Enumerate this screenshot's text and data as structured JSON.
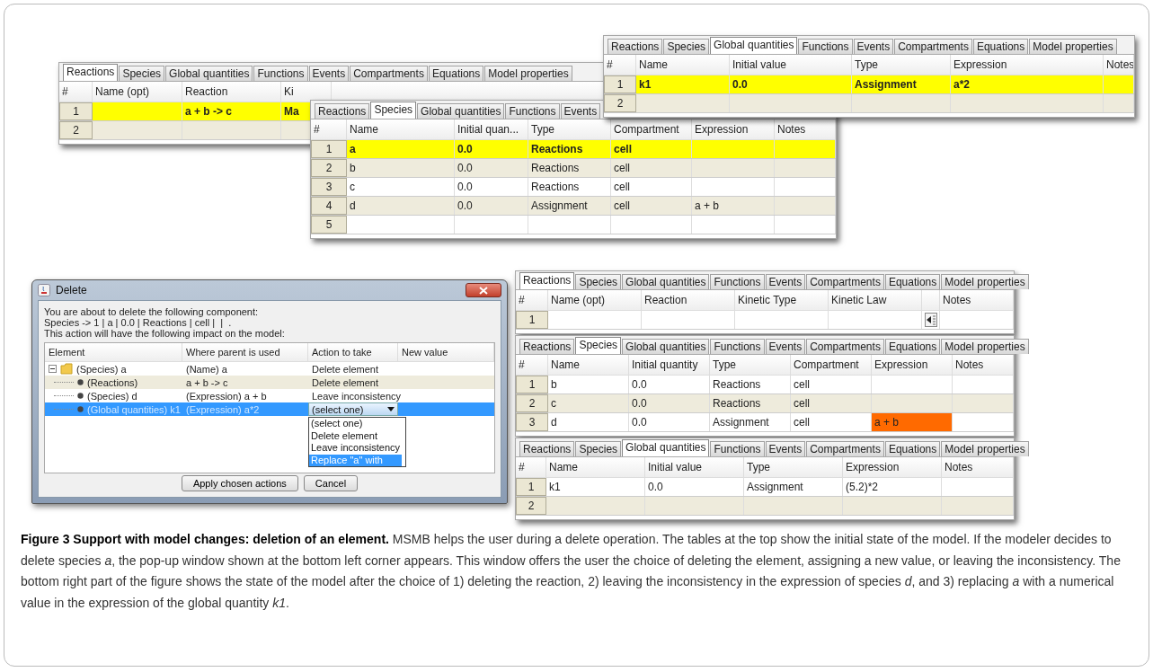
{
  "panels": [
    {
      "tabs": [
        {
          "label": "Reactions",
          "selected": true
        },
        {
          "label": "Species",
          "selected": false
        },
        {
          "label": "Global quantities",
          "selected": false
        },
        {
          "label": "Functions",
          "selected": false
        },
        {
          "label": "Events",
          "selected": false
        },
        {
          "label": "Compartments",
          "selected": false
        },
        {
          "label": "Equations",
          "selected": false
        },
        {
          "label": "Model properties",
          "selected": false
        }
      ],
      "columns": [
        "#",
        "Name (opt)",
        "Reaction",
        "Ki"
      ],
      "editor_column": false,
      "rows": [
        {
          "highlighted": true,
          "cells": [
            "1",
            null,
            "a + b -> c",
            "Ma"
          ]
        },
        {
          "highlighted": false,
          "cells": [
            "2"
          ]
        }
      ]
    },
    {
      "tabs": [
        {
          "label": "Reactions",
          "selected": false
        },
        {
          "label": "Species",
          "selected": false
        },
        {
          "label": "Global quantities",
          "selected": true
        },
        {
          "label": "Functions",
          "selected": false
        },
        {
          "label": "Events",
          "selected": false
        },
        {
          "label": "Compartments",
          "selected": false
        },
        {
          "label": "Equations",
          "selected": false
        },
        {
          "label": "Model properties",
          "selected": false
        }
      ],
      "columns": [
        "#",
        "Name",
        "Initial value",
        "Type",
        "Expression",
        "Notes"
      ],
      "editor_column": false,
      "rows": [
        {
          "highlighted": true,
          "cells": [
            "1",
            "k1",
            "0.0",
            "Assignment",
            "a*2",
            null
          ]
        },
        {
          "highlighted": false,
          "cells": [
            "2"
          ]
        }
      ]
    },
    {
      "tabs": [
        {
          "label": "Reactions",
          "selected": false
        },
        {
          "label": "Species",
          "selected": true
        },
        {
          "label": "Global quantities",
          "selected": false
        },
        {
          "label": "Functions",
          "selected": false
        },
        {
          "label": "Events",
          "selected": false
        }
      ],
      "columns": [
        "#",
        "Name",
        "Initial quan...",
        "Type",
        "Compartment",
        "Expression",
        "Notes"
      ],
      "editor_column": false,
      "rows": [
        {
          "highlighted": true,
          "cells": [
            "1",
            "a",
            "0.0",
            "Reactions",
            "cell",
            null,
            null
          ]
        },
        {
          "highlighted": false,
          "cells": [
            "2",
            "b",
            "0.0",
            "Reactions",
            "cell",
            null,
            null
          ]
        },
        {
          "highlighted": false,
          "cells": [
            "3",
            "c",
            "0.0",
            "Reactions",
            "cell",
            null,
            null
          ]
        },
        {
          "highlighted": false,
          "cells": [
            "4",
            "d",
            "0.0",
            "Assignment",
            "cell",
            "a + b",
            null
          ]
        },
        {
          "highlighted": false,
          "cells": [
            "5"
          ]
        }
      ]
    },
    {
      "tabs": [
        {
          "label": "Reactions",
          "selected": true
        },
        {
          "label": "Species",
          "selected": false
        },
        {
          "label": "Global quantities",
          "selected": false
        },
        {
          "label": "Functions",
          "selected": false
        },
        {
          "label": "Events",
          "selected": false
        },
        {
          "label": "Compartments",
          "selected": false
        },
        {
          "label": "Equations",
          "selected": false
        },
        {
          "label": "Model properties",
          "selected": false
        }
      ],
      "columns": [
        "#",
        "Name (opt)",
        "Reaction",
        "Kinetic Type",
        "Kinetic Law",
        "Notes"
      ],
      "editor_column": true,
      "rows": [
        {
          "highlighted": false,
          "cells": [
            "1"
          ]
        }
      ]
    },
    {
      "tabs": [
        {
          "label": "Reactions",
          "selected": false
        },
        {
          "label": "Species",
          "selected": true
        },
        {
          "label": "Global quantities",
          "selected": false
        },
        {
          "label": "Functions",
          "selected": false
        },
        {
          "label": "Events",
          "selected": false
        },
        {
          "label": "Compartments",
          "selected": false
        },
        {
          "label": "Equations",
          "selected": false
        },
        {
          "label": "Model properties",
          "selected": false
        }
      ],
      "columns": [
        "#",
        "Name",
        "Initial quantity",
        "Type",
        "Compartment",
        "Expression",
        "Notes"
      ],
      "editor_column": false,
      "rows": [
        {
          "highlighted": false,
          "cells": [
            "1",
            "b",
            "0.0",
            "Reactions",
            "cell",
            null,
            null
          ]
        },
        {
          "highlighted": false,
          "cells": [
            "2",
            "c",
            "0.0",
            "Reactions",
            "cell",
            null,
            null
          ]
        },
        {
          "highlighted": false,
          "cells": [
            "3",
            "d",
            "0.0",
            "Assignment",
            "cell",
            {
              "text": "a + b",
              "invalid": true
            },
            null
          ]
        }
      ]
    },
    {
      "tabs": [
        {
          "label": "Reactions",
          "selected": false
        },
        {
          "label": "Species",
          "selected": false
        },
        {
          "label": "Global quantities",
          "selected": true
        },
        {
          "label": "Functions",
          "selected": false
        },
        {
          "label": "Events",
          "selected": false
        },
        {
          "label": "Compartments",
          "selected": false
        },
        {
          "label": "Equations",
          "selected": false
        },
        {
          "label": "Model properties",
          "selected": false
        }
      ],
      "columns": [
        "#",
        "Name",
        "Initial value",
        "Type",
        "Expression",
        "Notes"
      ],
      "editor_column": false,
      "rows": [
        {
          "highlighted": false,
          "cells": [
            "1",
            "k1",
            "0.0",
            "Assignment",
            "(5.2)*2",
            null
          ]
        },
        {
          "highlighted": false,
          "cells": [
            "2"
          ]
        }
      ]
    }
  ],
  "dialog": {
    "title": "Delete",
    "message": [
      "You are about to delete the following component:",
      "Species -> 1 | a | 0.0 | Reactions | cell |  |  .",
      "This action will have the following impact on the model:"
    ],
    "columns": [
      "Element",
      "Where parent is used",
      "Action to take",
      "New value"
    ],
    "tree": {
      "element": "(Species) a",
      "where_used": "(Name) a",
      "kind": "text",
      "action": "Delete element",
      "expanded": true,
      "selected": false,
      "children": [
        {
          "element": "(Reactions)",
          "where_used": "a + b -> c",
          "kind": "text",
          "action": "Delete element",
          "selected": false
        },
        {
          "element": "(Species) d",
          "where_used": "(Expression) a + b",
          "kind": "text",
          "action": "Leave inconsistency",
          "selected": false
        },
        {
          "element": "(Global quantities) k1",
          "where_used": "(Expression) a*2",
          "kind": "dropdown",
          "action": "(select one)",
          "selected": true
        }
      ]
    },
    "dropdown_options": [
      {
        "label": "(select one)",
        "selected": false
      },
      {
        "label": "Delete element",
        "selected": false
      },
      {
        "label": "Leave inconsistency",
        "selected": false
      },
      {
        "label": "Replace \"a\" with",
        "selected": true
      }
    ],
    "buttons": [
      "Apply chosen actions",
      "Cancel"
    ]
  },
  "caption": "**Figure 3 Support with model changes: deletion of an element.** MSMB helps the user during a delete operation. The tables at the top show the initial state of the model. If the modeler decides to delete species *a*, the pop-up window shown at the bottom left corner appears. This window offers the user the choice of deleting the element, assigning a new value, or leaving the inconsistency. The bottom right part of the figure shows the state of the model after the choice of 1) deleting the reaction, 2) leaving the inconsistency in the expression of species *d*, and 3) replacing *a* with a numerical value in the expression of the global quantity *k1*."
}
